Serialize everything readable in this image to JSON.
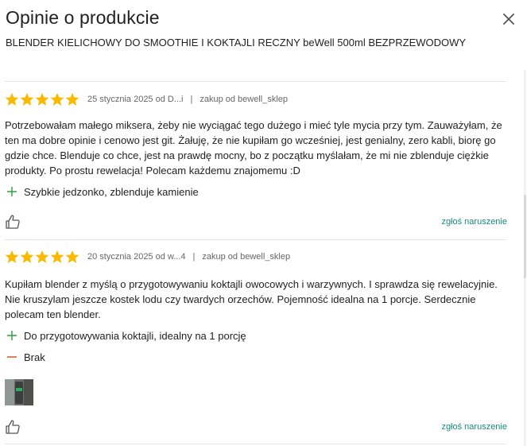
{
  "header": {
    "title": "Opinie o produkcie",
    "product_name": "BLENDER KIELICHOWY DO SMOOTHIE I KOKTAJLI RECZNY beWell 500ml BEZPRZEWODOWY"
  },
  "colors": {
    "star": "#fbb800",
    "link": "#1a8a7b",
    "pro": "#2e9e3d",
    "con": "#d2481b"
  },
  "reviews": [
    {
      "rating": 5,
      "date_author": "25 stycznia 2025 od D...i",
      "purchase": "zakup od bewell_sklep",
      "text": "Potrzebowałam małego miksera, żeby nie wyciągać tego dużego i mieć tyle mycia przy tym. Zauważyłam, że ten ma dobre opinie i cenowo jest git. Żałuję, że nie kupiłam go wcześniej, jest genialny, zero kabli, biorę go gdzie chce. Blenduje co chce, jest na prawdę mocny, bo z początku myślałam, że mi nie zblenduje ciężkie produkty. Po prostu rewelacja! Polecam każdemu znajomemu :D",
      "pro": "Szybkie jedzonko, zblenduje kamienie",
      "report": "zgłoś naruszenie"
    },
    {
      "rating": 5,
      "date_author": "20 stycznia 2025 od w...4",
      "purchase": "zakup od bewell_sklep",
      "text": "Kupiłam blender z myślą o przygotowywaniu koktajli owocowych i warzywnych. I sprawdza się rewelacyjnie. Nie kruszylam jeszcze kostek lodu czy twardych orzechów. Pojemność idealna na 1 porcje. Serdecznie polecam ten blender.",
      "pro": "Do przygotowywania koktajli, idealny na 1 porcję",
      "con": "Brak",
      "report": "zgłoś naruszenie"
    }
  ]
}
